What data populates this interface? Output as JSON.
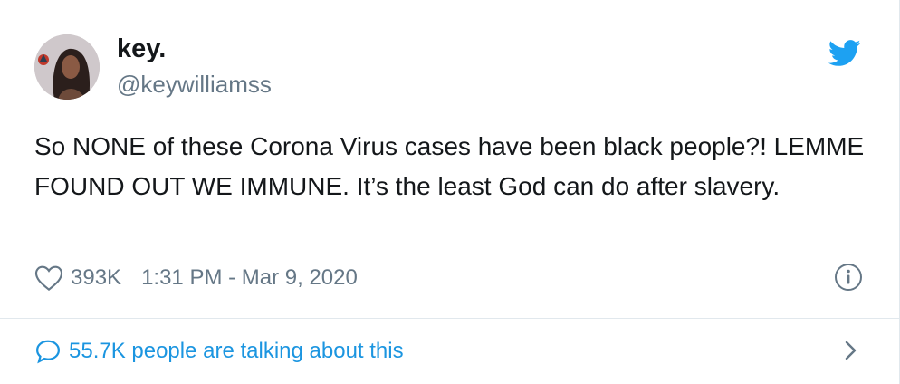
{
  "author": {
    "display_name": "key.",
    "handle": "@keywilliamss"
  },
  "tweet": {
    "text": "So NONE of these Corona Virus cases have been black people?! LEMME FOUND OUT WE IMMUNE. It’s the least God can do after slavery.",
    "likes": "393K",
    "timestamp": "1:31 PM - Mar 9, 2020"
  },
  "footer": {
    "talking_label": "55.7K people are talking about this"
  },
  "icons": {
    "brand": "twitter-bird-icon",
    "like": "heart-icon",
    "info": "info-icon",
    "reply": "speech-bubble-icon",
    "more": "chevron-right-icon"
  },
  "colors": {
    "brand_blue": "#1da1f2",
    "link_blue": "#1b95e0",
    "text": "#14171a",
    "secondary": "#657786",
    "divider": "#e1e8ed"
  }
}
